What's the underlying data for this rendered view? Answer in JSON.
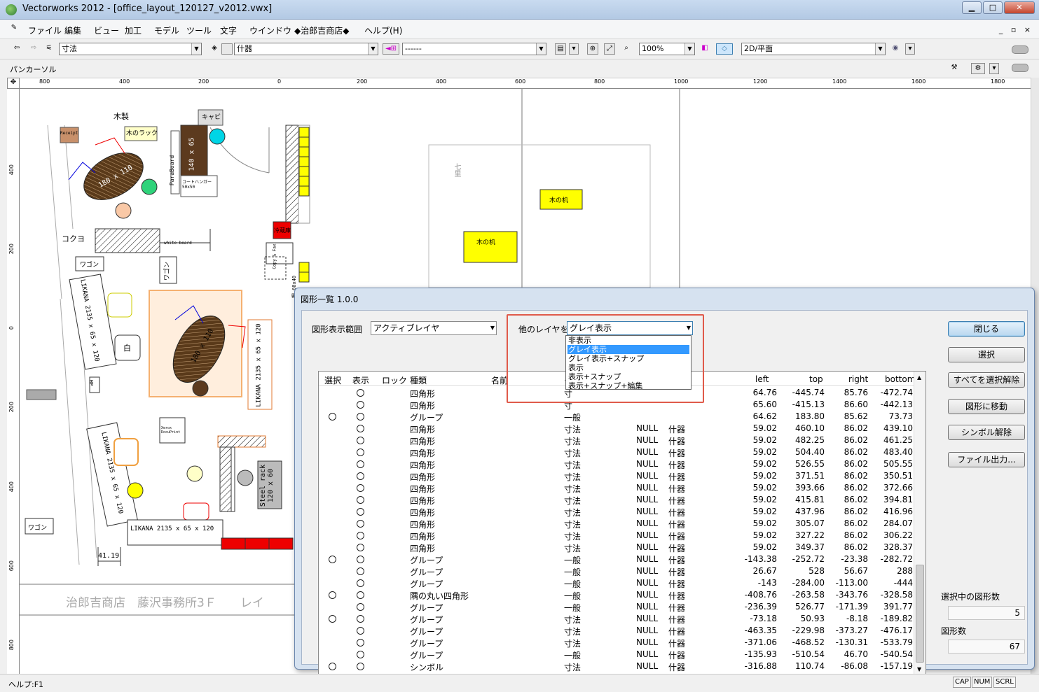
{
  "window": {
    "title": "Vectorworks 2012 - [office_layout_120127_v2012.vwx]",
    "controls": [
      "▁",
      "□",
      "✕"
    ]
  },
  "menu": [
    "ファイル",
    "編集",
    "ビュー",
    "加工",
    "モデル",
    "ツール",
    "文字",
    "ウインドウ",
    "◆治郎吉商店◆",
    "ヘルプ(H)"
  ],
  "mdi_controls": "_ ▫ ×",
  "toolbar": {
    "class_combo": "寸法",
    "layer_combo": "什器",
    "view_combo": "------",
    "zoom": "100%",
    "projection": "2D/平面"
  },
  "mode_label": "パンカーソル",
  "ruler_h": [
    "800",
    "400",
    "200",
    "0",
    "200",
    "400",
    "600",
    "800",
    "1000",
    "1200",
    "1400",
    "1600",
    "1800"
  ],
  "ruler_v": [
    "400",
    "200",
    "0",
    "200",
    "400",
    "600",
    "800"
  ],
  "canvas_texts": {
    "mokusei": "木製",
    "kyabi": "キャビ",
    "receipt": "Receipt",
    "wood_rack": "木のラック",
    "table1": "180 x 110",
    "paraboard": "ParaBoard",
    "cabinet": "140 x 65",
    "coat": "コートハンガー 50x50",
    "kokuyo": "コクヨ",
    "whiteboard": "white board",
    "reizouko": "冷蔵庫",
    "wagon1": "ワゴン",
    "wagon2": "ワゴン",
    "wagon3": "ワゴン",
    "likana1": "LIKANA 2135 x 65 x 120",
    "likana2": "LIKANA 2135 x 65 x 120",
    "likana3": "LIKANA 2135 x 65 x 120",
    "likana4": "LIKANA 2135 x 65 x 120",
    "shiro": "白",
    "hp": "HP",
    "xerox": "Xerox DocuPrint",
    "steel": "Steel rack 120 x 60",
    "dim": "41.19",
    "table2": "180 x 110",
    "desk1": "木の机",
    "desk2": "木の机",
    "washitsu": "七里",
    "shelf": "棚 60x40",
    "fax": "Copy & Fax",
    "footer": "治郎吉商店　藤沢事務所3Ｆ　　レイ"
  },
  "dialog": {
    "title": "図形一覧 1.0.0",
    "scope_label": "図形表示範囲",
    "scope_value": "アクティブレイヤ",
    "other_label": "他のレイヤを",
    "other_value": "グレイ表示",
    "dropdown_options": [
      "非表示",
      "グレイ表示",
      "グレイ表示+スナップ",
      "表示",
      "表示+スナップ",
      "表示+スナップ+編集"
    ],
    "selected_option_index": 1,
    "buttons": [
      "閉じる",
      "選択",
      "すべてを選択解除",
      "図形に移動",
      "シンボル解除",
      "ファイル出力..."
    ],
    "selected_count_label": "選択中の図形数",
    "selected_count": "5",
    "total_count_label": "図形数",
    "total_count": "67",
    "columns": [
      "選択",
      "表示",
      "ロック",
      "種類",
      "名前",
      "ク",
      "",
      "",
      "left",
      "top",
      "right",
      "bottom"
    ],
    "rows": [
      [
        "",
        "○",
        "",
        "四角形",
        "",
        "寸",
        "",
        "",
        "64.76",
        "-445.74",
        "85.76",
        "-472.74"
      ],
      [
        "",
        "○",
        "",
        "四角形",
        "",
        "寸",
        "",
        "",
        "65.60",
        "-415.13",
        "86.60",
        "-442.13"
      ],
      [
        "○",
        "○",
        "",
        "グループ",
        "",
        "一般",
        "",
        "",
        "64.62",
        "183.80",
        "85.62",
        "73.73"
      ],
      [
        "",
        "○",
        "",
        "四角形",
        "",
        "寸法",
        "NULL",
        "什器",
        "59.02",
        "460.10",
        "86.02",
        "439.10"
      ],
      [
        "",
        "○",
        "",
        "四角形",
        "",
        "寸法",
        "NULL",
        "什器",
        "59.02",
        "482.25",
        "86.02",
        "461.25"
      ],
      [
        "",
        "○",
        "",
        "四角形",
        "",
        "寸法",
        "NULL",
        "什器",
        "59.02",
        "504.40",
        "86.02",
        "483.40"
      ],
      [
        "",
        "○",
        "",
        "四角形",
        "",
        "寸法",
        "NULL",
        "什器",
        "59.02",
        "526.55",
        "86.02",
        "505.55"
      ],
      [
        "",
        "○",
        "",
        "四角形",
        "",
        "寸法",
        "NULL",
        "什器",
        "59.02",
        "371.51",
        "86.02",
        "350.51"
      ],
      [
        "",
        "○",
        "",
        "四角形",
        "",
        "寸法",
        "NULL",
        "什器",
        "59.02",
        "393.66",
        "86.02",
        "372.66"
      ],
      [
        "",
        "○",
        "",
        "四角形",
        "",
        "寸法",
        "NULL",
        "什器",
        "59.02",
        "415.81",
        "86.02",
        "394.81"
      ],
      [
        "",
        "○",
        "",
        "四角形",
        "",
        "寸法",
        "NULL",
        "什器",
        "59.02",
        "437.96",
        "86.02",
        "416.96"
      ],
      [
        "",
        "○",
        "",
        "四角形",
        "",
        "寸法",
        "NULL",
        "什器",
        "59.02",
        "305.07",
        "86.02",
        "284.07"
      ],
      [
        "",
        "○",
        "",
        "四角形",
        "",
        "寸法",
        "NULL",
        "什器",
        "59.02",
        "327.22",
        "86.02",
        "306.22"
      ],
      [
        "",
        "○",
        "",
        "四角形",
        "",
        "寸法",
        "NULL",
        "什器",
        "59.02",
        "349.37",
        "86.02",
        "328.37"
      ],
      [
        "○",
        "○",
        "",
        "グループ",
        "",
        "一般",
        "NULL",
        "什器",
        "-143.38",
        "-252.72",
        "-23.38",
        "-282.72"
      ],
      [
        "",
        "○",
        "",
        "グループ",
        "",
        "一般",
        "NULL",
        "什器",
        "26.67",
        "528",
        "56.67",
        "288"
      ],
      [
        "",
        "○",
        "",
        "グループ",
        "",
        "一般",
        "NULL",
        "什器",
        "-143",
        "-284.00",
        "-113.00",
        "-444"
      ],
      [
        "○",
        "○",
        "",
        "隅の丸い四角形",
        "",
        "一般",
        "NULL",
        "什器",
        "-408.76",
        "-263.58",
        "-343.76",
        "-328.58"
      ],
      [
        "",
        "○",
        "",
        "グループ",
        "",
        "一般",
        "NULL",
        "什器",
        "-236.39",
        "526.77",
        "-171.39",
        "391.77"
      ],
      [
        "○",
        "○",
        "",
        "グループ",
        "",
        "寸法",
        "NULL",
        "什器",
        "-73.18",
        "50.93",
        "-8.18",
        "-189.82"
      ],
      [
        "",
        "○",
        "",
        "グループ",
        "",
        "寸法",
        "NULL",
        "什器",
        "-463.35",
        "-229.98",
        "-373.27",
        "-476.17"
      ],
      [
        "",
        "○",
        "",
        "グループ",
        "",
        "寸法",
        "NULL",
        "什器",
        "-371.06",
        "-468.52",
        "-130.31",
        "-533.79"
      ],
      [
        "",
        "○",
        "",
        "グループ",
        "",
        "一般",
        "NULL",
        "什器",
        "-135.93",
        "-510.54",
        "46.70",
        "-540.54"
      ],
      [
        "○",
        "○",
        "",
        "シンボル",
        "",
        "寸法",
        "NULL",
        "什器",
        "-316.88",
        "110.74",
        "-86.08",
        "-157.19"
      ]
    ]
  },
  "status": {
    "help": "ヘルプ:F1",
    "cap": "CAP",
    "num": "NUM",
    "scrl": "SCRL"
  }
}
